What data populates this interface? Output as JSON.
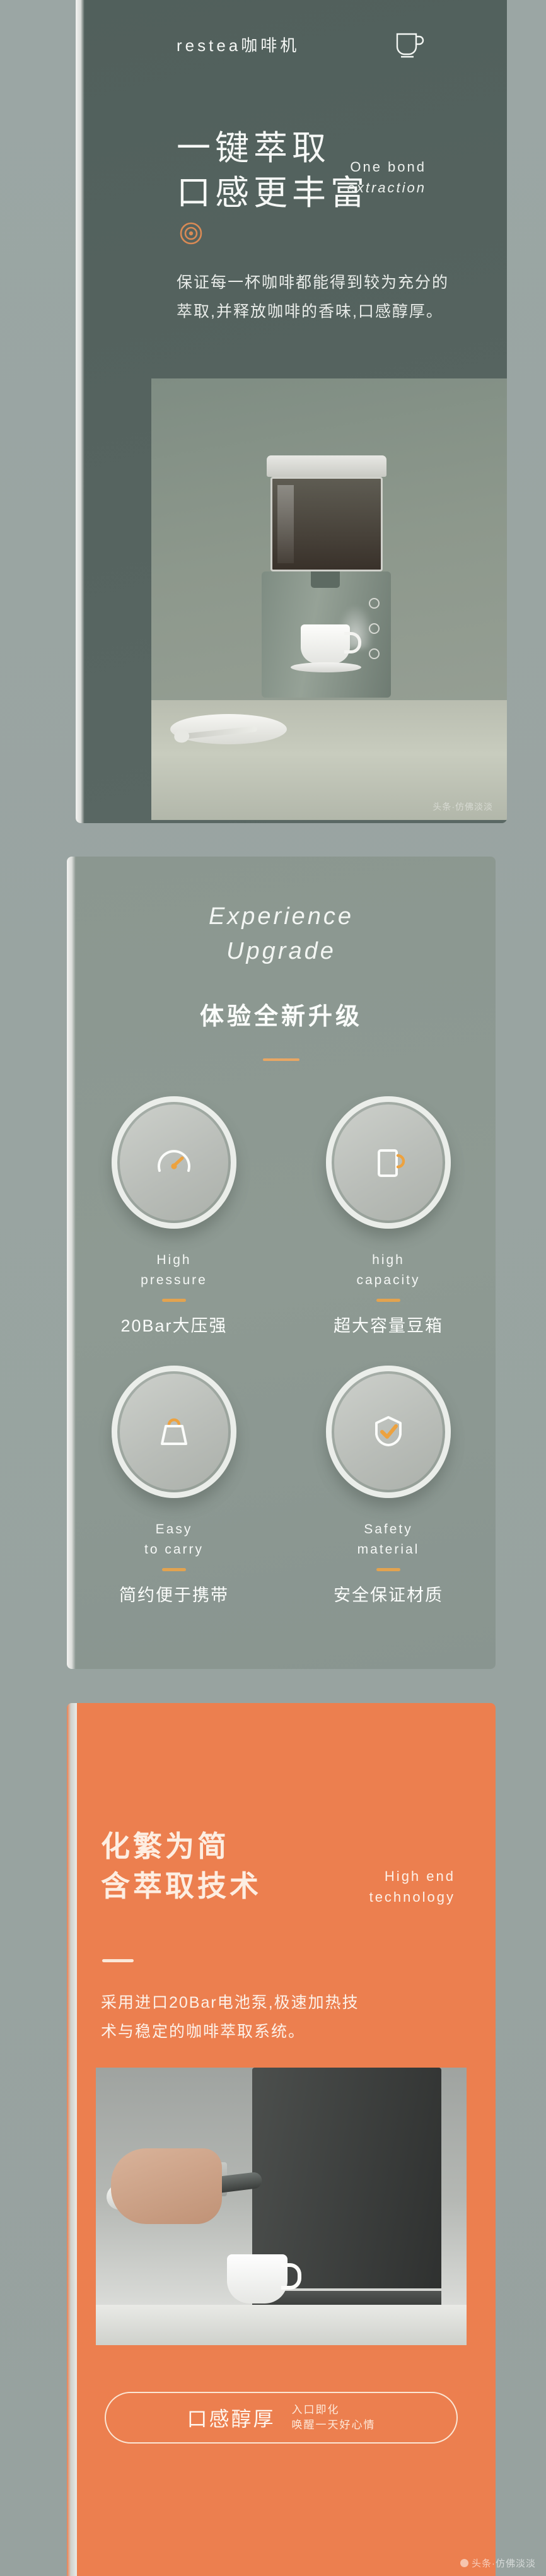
{
  "theme": {
    "hero_bg": "#55635f",
    "section2_bg": "#8e9a93",
    "section3_bg": "#ec7f4f",
    "accent_orange": "#e8a663",
    "page_bg": "#9aa5a3",
    "text_light": "#f6f8f6"
  },
  "hero": {
    "logo": "restea咖啡机",
    "logo_icon": "coffee-cup-icon",
    "headline_line1": "一键萃取",
    "headline_line2": "口感更丰富",
    "english_line1": "One bond",
    "english_line2": "extraction",
    "marker_icon": "target-circles-icon",
    "body_line1": "保证每一杯咖啡都能得到较为充分的",
    "body_line2": "萃取,并释放咖啡的香味,口感醇厚。",
    "photo_alt": "coffee-machine-photo"
  },
  "experience": {
    "english_line1": "Experience",
    "english_line2": "Upgrade",
    "chinese_title": "体验全新升级",
    "features": [
      {
        "icon": "pressure-gauge-icon",
        "en_line1": "High",
        "en_line2": "pressure",
        "cn": "20Bar大压强"
      },
      {
        "icon": "coffee-mug-icon",
        "en_line1": "high",
        "en_line2": "capacity",
        "cn": "超大容量豆箱"
      },
      {
        "icon": "handbag-icon",
        "en_line1": "Easy",
        "en_line2": "to carry",
        "cn": "简约便于携带"
      },
      {
        "icon": "shield-check-icon",
        "en_line1": "Safety",
        "en_line2": "material",
        "cn": "安全保证材质"
      }
    ]
  },
  "technology": {
    "headline_line1": "化繁为简",
    "headline_line2": "含萃取技术",
    "english_line1": "High end",
    "english_line2": "technology",
    "body_line1": "采用进口20Bar电池泵,极速加热技",
    "body_line2": "术与稳定的咖啡萃取系统。",
    "photo_alt": "espresso-portafilter-photo",
    "cta_main": "口感醇厚",
    "cta_sub_line1": "入口即化",
    "cta_sub_line2": "唤醒一天好心情"
  },
  "watermark": {
    "text": "头条·仿佛淡淡"
  }
}
